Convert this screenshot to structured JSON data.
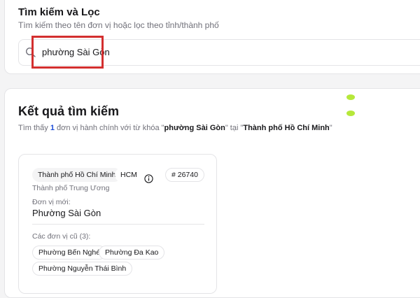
{
  "search": {
    "title": "Tìm kiếm và Lọc",
    "subtitle": "Tìm kiếm theo tên đơn vị hoặc lọc theo tỉnh/thành phố",
    "value": "phường Sài Gòn",
    "icon": "search-icon"
  },
  "results": {
    "title": "Kết quả tìm kiếm",
    "summary_prefix": "Tìm thấy ",
    "count": "1",
    "summary_mid": " đơn vị hành chính với từ khóa \"",
    "keyword": "phường Sài Gòn",
    "summary_mid2": "\" tại \"",
    "location": "Thành phố Hồ Chí Minh",
    "summary_suffix": "\""
  },
  "card": {
    "province": "Thành phố Hồ Chí Minh",
    "code_short": "HCM",
    "id": "# 26740",
    "province_type": "Thành phố Trung Ương",
    "new_unit_label": "Đơn vị mới:",
    "new_unit_name": "Phường Sài Gòn",
    "old_units_label": "Các đơn vị cũ (3):",
    "old_units": [
      "Phường Bến Nghé",
      "Phường Đa Kao",
      "Phường Nguyễn Thái Bình"
    ],
    "info_icon": "info-icon"
  },
  "colors": {
    "highlight": "#d32f2f",
    "accent_count": "#1d4ed8",
    "status_dot": "#b6e83a"
  }
}
